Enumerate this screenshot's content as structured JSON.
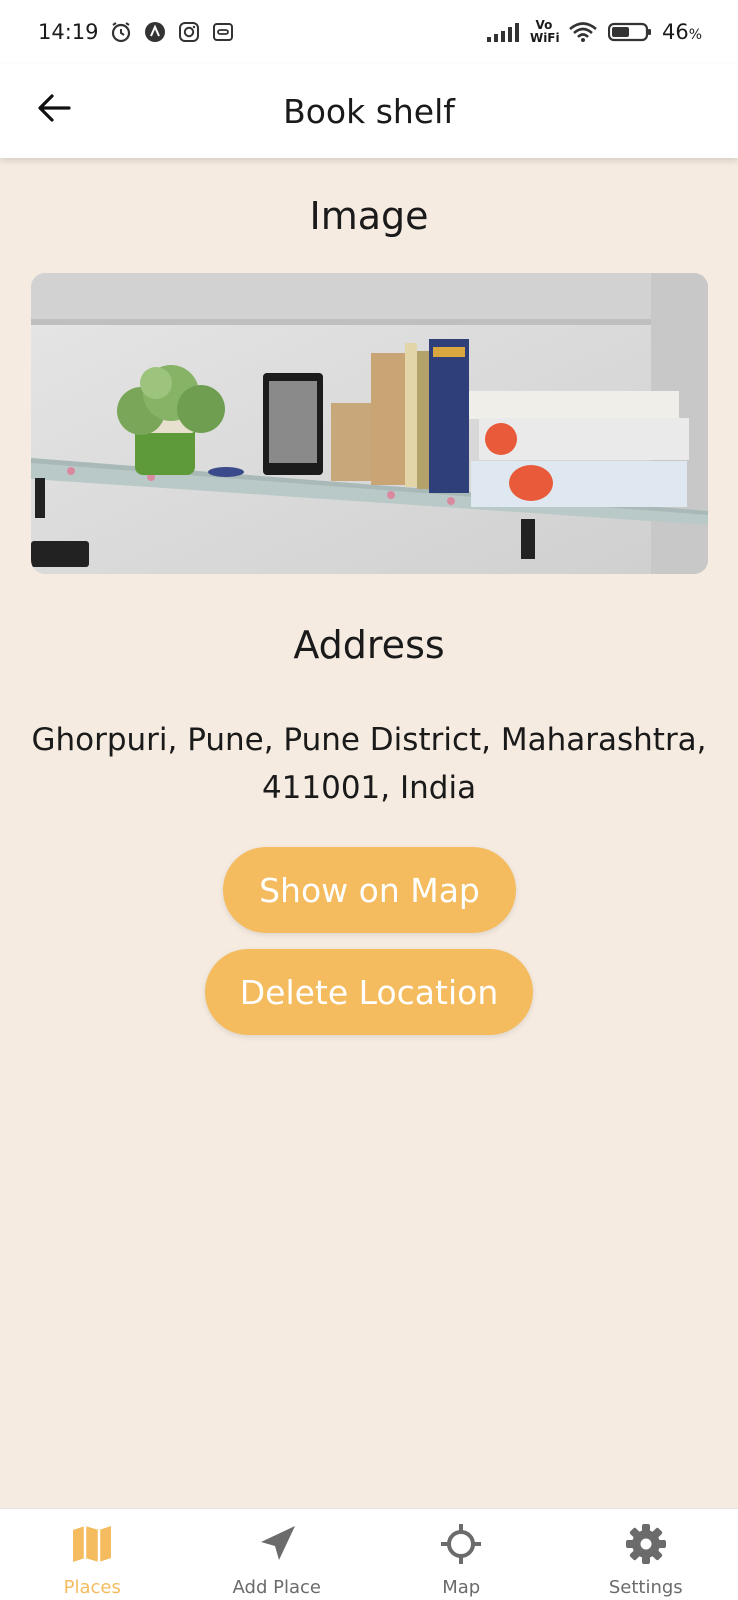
{
  "status_bar": {
    "time": "14:19",
    "network_label": "Vo WiFi",
    "battery_percent": "46",
    "battery_suffix": "%"
  },
  "app_bar": {
    "title": "Book shelf"
  },
  "content": {
    "image_heading": "Image",
    "address_heading": "Address",
    "address_line1": "Ghorpuri, Pune, Pune District, Maharashtra,",
    "address_line2": "411001, India",
    "show_on_map_label": "Show on Map",
    "delete_location_label": "Delete Location"
  },
  "bottom_nav": {
    "items": [
      {
        "label": "Places",
        "icon": "map-icon",
        "active": true
      },
      {
        "label": "Add Place",
        "icon": "navigation-arrow-icon",
        "active": false
      },
      {
        "label": "Map",
        "icon": "location-target-icon",
        "active": false
      },
      {
        "label": "Settings",
        "icon": "gear-icon",
        "active": false
      }
    ]
  },
  "colors": {
    "background": "#f5ebe1",
    "accent": "#f4bc5e",
    "inactive": "#6b6b6b"
  }
}
